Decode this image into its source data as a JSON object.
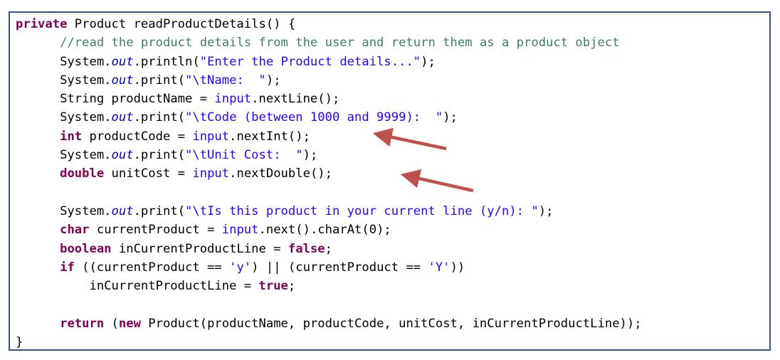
{
  "code_lines": [
    [
      {
        "t": "private",
        "c": "kw"
      },
      {
        "t": " Product readProductDetails() {",
        "c": "txt"
      }
    ],
    [
      {
        "t": "      ",
        "c": "txt"
      },
      {
        "t": "//read the product details from the user and return them as a product object",
        "c": "cmt"
      }
    ],
    [
      {
        "t": "      System.",
        "c": "txt"
      },
      {
        "t": "out",
        "c": "fld"
      },
      {
        "t": ".println(",
        "c": "txt"
      },
      {
        "t": "\"Enter the Product details...\"",
        "c": "str"
      },
      {
        "t": ");",
        "c": "txt"
      }
    ],
    [
      {
        "t": "      System.",
        "c": "txt"
      },
      {
        "t": "out",
        "c": "fld"
      },
      {
        "t": ".print(",
        "c": "txt"
      },
      {
        "t": "\"\\tName:  \"",
        "c": "str"
      },
      {
        "t": ");",
        "c": "txt"
      }
    ],
    [
      {
        "t": "      String productName = ",
        "c": "txt"
      },
      {
        "t": "input",
        "c": "str"
      },
      {
        "t": ".nextLine();",
        "c": "txt"
      }
    ],
    [
      {
        "t": "      System.",
        "c": "txt"
      },
      {
        "t": "out",
        "c": "fld"
      },
      {
        "t": ".print(",
        "c": "txt"
      },
      {
        "t": "\"\\tCode (between 1000 and 9999):  \"",
        "c": "str"
      },
      {
        "t": ");",
        "c": "txt"
      }
    ],
    [
      {
        "t": "      ",
        "c": "txt"
      },
      {
        "t": "int",
        "c": "kw"
      },
      {
        "t": " productCode = ",
        "c": "txt"
      },
      {
        "t": "input",
        "c": "str"
      },
      {
        "t": ".nextInt();",
        "c": "txt"
      }
    ],
    [
      {
        "t": "      System.",
        "c": "txt"
      },
      {
        "t": "out",
        "c": "fld"
      },
      {
        "t": ".print(",
        "c": "txt"
      },
      {
        "t": "\"\\tUnit Cost:  \"",
        "c": "str"
      },
      {
        "t": ");",
        "c": "txt"
      }
    ],
    [
      {
        "t": "      ",
        "c": "txt"
      },
      {
        "t": "double",
        "c": "kw"
      },
      {
        "t": " unitCost = ",
        "c": "txt"
      },
      {
        "t": "input",
        "c": "str"
      },
      {
        "t": ".nextDouble();",
        "c": "txt"
      }
    ],
    [
      {
        "t": "",
        "c": "txt"
      }
    ],
    [
      {
        "t": "      System.",
        "c": "txt"
      },
      {
        "t": "out",
        "c": "fld"
      },
      {
        "t": ".print(",
        "c": "txt"
      },
      {
        "t": "\"\\tIs this product in your current line (y/n): \"",
        "c": "str"
      },
      {
        "t": ");",
        "c": "txt"
      }
    ],
    [
      {
        "t": "      ",
        "c": "txt"
      },
      {
        "t": "char",
        "c": "kw"
      },
      {
        "t": " currentProduct = ",
        "c": "txt"
      },
      {
        "t": "input",
        "c": "str"
      },
      {
        "t": ".next().charAt(0);",
        "c": "txt"
      }
    ],
    [
      {
        "t": "      ",
        "c": "txt"
      },
      {
        "t": "boolean",
        "c": "kw"
      },
      {
        "t": " inCurrentProductLine = ",
        "c": "txt"
      },
      {
        "t": "false",
        "c": "kw"
      },
      {
        "t": ";",
        "c": "txt"
      }
    ],
    [
      {
        "t": "      ",
        "c": "txt"
      },
      {
        "t": "if",
        "c": "kw"
      },
      {
        "t": " ((currentProduct == ",
        "c": "txt"
      },
      {
        "t": "'y'",
        "c": "str"
      },
      {
        "t": ") || (currentProduct == ",
        "c": "txt"
      },
      {
        "t": "'Y'",
        "c": "str"
      },
      {
        "t": "))",
        "c": "txt"
      }
    ],
    [
      {
        "t": "          inCurrentProductLine = ",
        "c": "txt"
      },
      {
        "t": "true",
        "c": "kw"
      },
      {
        "t": ";",
        "c": "txt"
      }
    ],
    [
      {
        "t": "",
        "c": "txt"
      }
    ],
    [
      {
        "t": "      ",
        "c": "txt"
      },
      {
        "t": "return",
        "c": "kw"
      },
      {
        "t": " (",
        "c": "txt"
      },
      {
        "t": "new",
        "c": "kw"
      },
      {
        "t": " Product(productName, productCode, unitCost, inCurrentProductLine));",
        "c": "txt"
      }
    ],
    [
      {
        "t": "}",
        "c": "txt"
      }
    ]
  ],
  "colors": {
    "keyword": "#7f0055",
    "string": "#2a00ff",
    "comment": "#3f7f5f",
    "field": "#0000c0",
    "arrow": "#c0504d",
    "border": "#35547f"
  },
  "annotations": [
    {
      "type": "arrow",
      "target": "productCode-line"
    },
    {
      "type": "arrow",
      "target": "unitCost-line"
    }
  ]
}
